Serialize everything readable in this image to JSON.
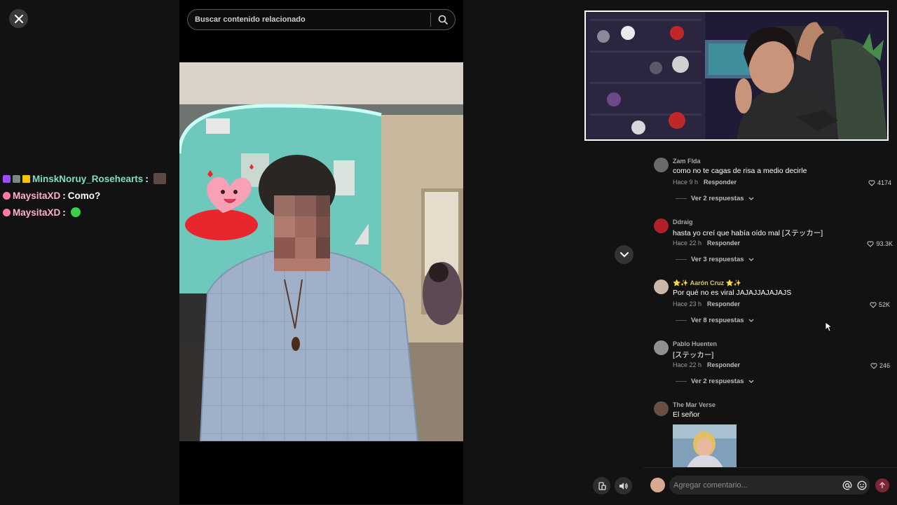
{
  "search": {
    "placeholder": "Buscar contenido relacionado"
  },
  "chat": [
    {
      "user": "MinskNoruy_Rosehearts",
      "sep": ":",
      "message": ""
    },
    {
      "user": "MaysitaXD",
      "sep": ":",
      "message": "Como?"
    },
    {
      "user": "MaysitaXD",
      "sep": ":",
      "message": ""
    }
  ],
  "comments": [
    {
      "user": "Zam Flda",
      "text": "como no te cagas de risa a medio decirle",
      "time": "Hace 9 h",
      "reply": "Responder",
      "likes": "4174",
      "replies": "Ver 2 respuestas"
    },
    {
      "user": "Ddraig",
      "text": "hasta yo creí que había oído mal [ステッカー]",
      "time": "Hace 22 h",
      "reply": "Responder",
      "likes": "93.3K",
      "replies": "Ver 3 respuestas"
    },
    {
      "user": "⭐✨ Aarón Cruz ⭐✨",
      "text": "Por qué no es viral JAJAJJAJAJAJS",
      "time": "Hace 23 h",
      "reply": "Responder",
      "likes": "52K",
      "replies": "Ver 8 respuestas"
    },
    {
      "user": "Pablo Huenten",
      "text": "[ステッカー]",
      "time": "Hace 22 h",
      "reply": "Responder",
      "likes": "246",
      "replies": "Ver 2 respuestas"
    },
    {
      "user": "The Mar Verse",
      "text": "El señor"
    }
  ],
  "comment_input": {
    "placeholder": "Agregar comentario..."
  },
  "colors": {
    "background": "#121212",
    "chat_name": "#7fe0c0",
    "send": "#7a2636"
  }
}
